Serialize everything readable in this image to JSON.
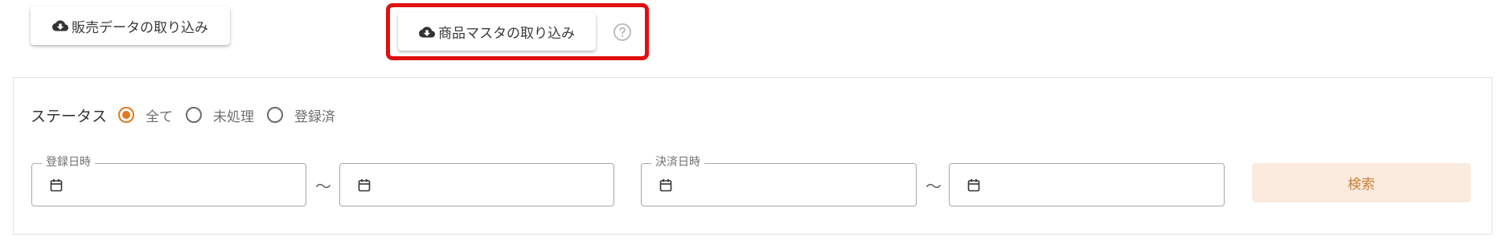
{
  "toolbar": {
    "sales_import_label": "販売データの取り込み",
    "product_import_label": "商品マスタの取り込み",
    "icon": "cloud-download-icon",
    "help_icon": "help-circle-icon"
  },
  "filter": {
    "status_label": "ステータス",
    "status_options": [
      {
        "label": "全て",
        "selected": true
      },
      {
        "label": "未処理",
        "selected": false
      },
      {
        "label": "登録済",
        "selected": false
      }
    ],
    "registered_date": {
      "legend": "登録日時",
      "from_value": "",
      "to_value": ""
    },
    "payment_date": {
      "legend": "決済日時",
      "from_value": "",
      "to_value": ""
    },
    "range_separator": "～",
    "search_label": "検索"
  },
  "colors": {
    "accent": "#e07a1f",
    "highlight": "#e01010",
    "search_bg": "#fbeade",
    "search_text": "#c9803a"
  }
}
